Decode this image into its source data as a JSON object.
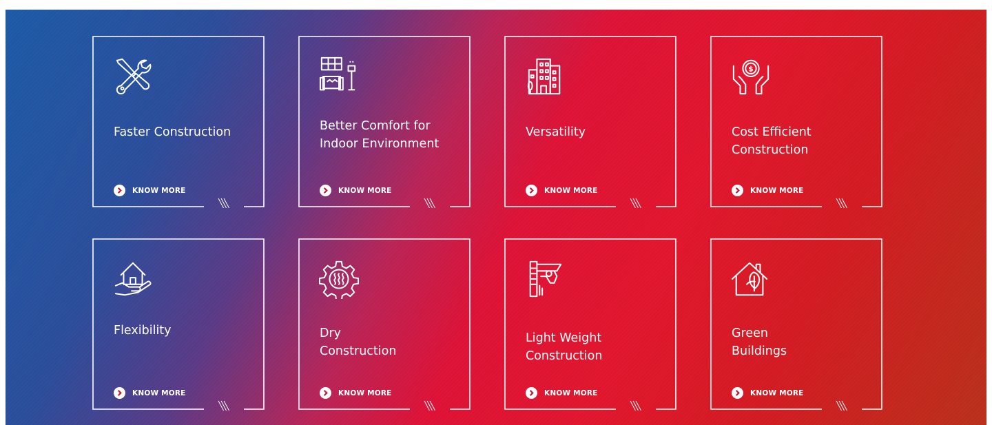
{
  "cta_label": "KNOW MORE",
  "colors": {
    "line": "#ffffff",
    "grad_start": "#1d5aa6",
    "grad_mid": "#dd1236",
    "grad_end": "#b8301b"
  },
  "cards": [
    {
      "title": "Faster Construction",
      "icon": "tools-wrench-screwdriver-icon"
    },
    {
      "title": "Better Comfort for\nIndoor Environment",
      "icon": "sofa-window-lamp-icon"
    },
    {
      "title": "Versatility",
      "icon": "buildings-icon"
    },
    {
      "title": "Cost Efficient\nConstruction",
      "icon": "hands-coin-icon"
    },
    {
      "title": "Flexibility",
      "icon": "house-in-hand-icon"
    },
    {
      "title": "Dry\nConstruction",
      "icon": "gear-heat-icon"
    },
    {
      "title": "Light Weight\nConstruction",
      "icon": "caliper-icon"
    },
    {
      "title": "Green\nBuildings",
      "icon": "house-leaf-icon"
    }
  ]
}
